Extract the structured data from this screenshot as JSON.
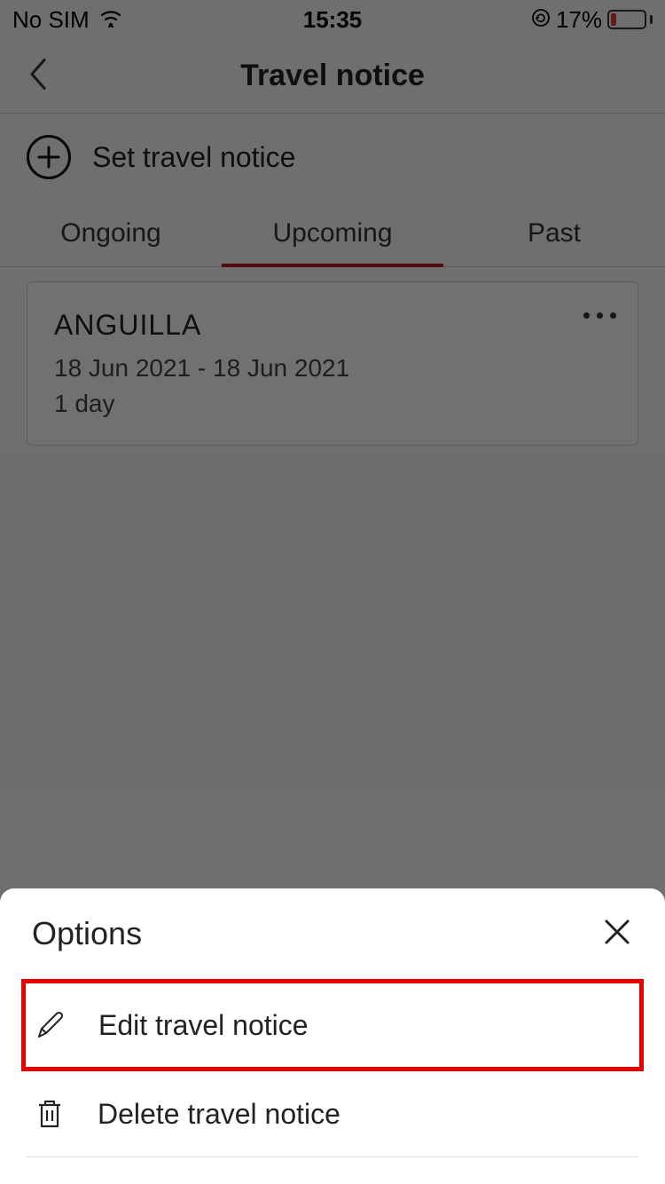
{
  "status": {
    "carrier": "No SIM",
    "time": "15:35",
    "battery_pct": "17%",
    "battery_fill_pct": 17
  },
  "header": {
    "title": "Travel notice"
  },
  "action": {
    "set_notice": "Set travel notice"
  },
  "tabs": {
    "ongoing": "Ongoing",
    "upcoming": "Upcoming",
    "past": "Past"
  },
  "card": {
    "country": "ANGUILLA",
    "date_range": "18 Jun 2021 - 18 Jun 2021",
    "duration": "1 day"
  },
  "sheet": {
    "title": "Options",
    "edit": "Edit travel notice",
    "delete": "Delete travel notice"
  }
}
